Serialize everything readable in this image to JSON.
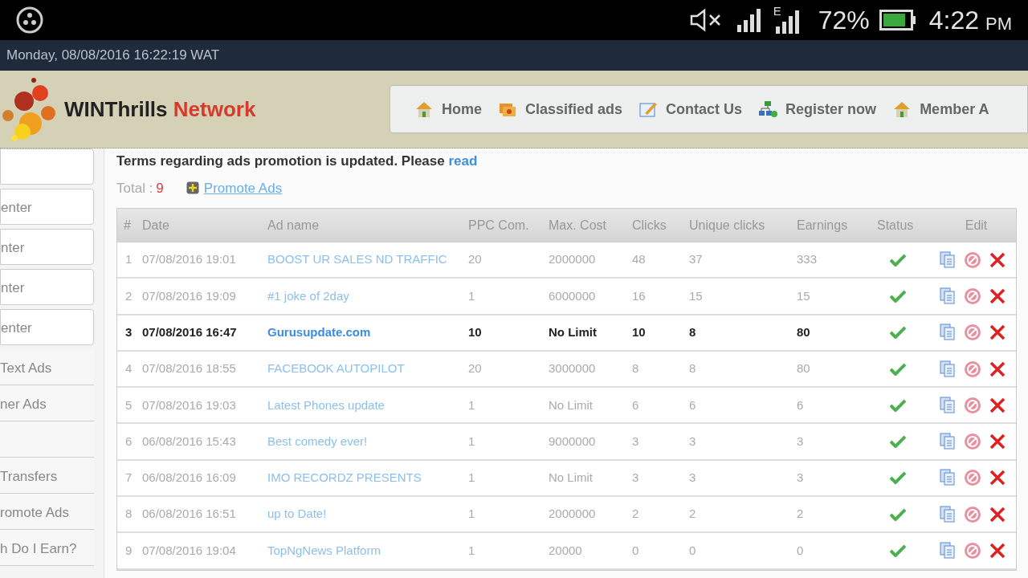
{
  "phone_status": {
    "network_type": "E",
    "battery": "72%",
    "time": "4:22",
    "ampm": "PM",
    "muted": true
  },
  "date_bar": "Monday, 08/08/2016 16:22:19 WAT",
  "logo": {
    "brand": "WINThrills",
    "suffix": "Network"
  },
  "nav": [
    {
      "label": "Home"
    },
    {
      "label": "Classified ads"
    },
    {
      "label": "Contact Us"
    },
    {
      "label": "Register now"
    },
    {
      "label": "Member A"
    }
  ],
  "sidebar": [
    {
      "kind": "box"
    },
    {
      "kind": "box",
      "label": "enter"
    },
    {
      "kind": "box",
      "label": "nter"
    },
    {
      "kind": "box",
      "label": "nter"
    },
    {
      "kind": "box",
      "label": "enter"
    },
    {
      "kind": "row",
      "label": "Text Ads"
    },
    {
      "kind": "row",
      "label": "ner Ads"
    },
    {
      "kind": "row"
    },
    {
      "kind": "row",
      "label": "Transfers"
    },
    {
      "kind": "row",
      "label": "romote Ads"
    },
    {
      "kind": "row",
      "label": "h Do I Earn?"
    }
  ],
  "notice": {
    "text": "Terms regarding ads promotion is updated. Please",
    "link": "read"
  },
  "total": {
    "label": "Total :",
    "value": "9"
  },
  "promote_link": "Promote Ads",
  "table": {
    "columns": [
      "#",
      "Date",
      "Ad name",
      "PPC Com.",
      "Max. Cost",
      "Clicks",
      "Unique clicks",
      "Earnings",
      "Status",
      "Edit"
    ],
    "rows": [
      {
        "cells": [
          "1",
          "07/08/2016 19:01",
          "BOOST UR SALES ND TRAFFIC",
          "20",
          "2000000",
          "48",
          "37",
          "333"
        ],
        "highlighted": false,
        "active": true
      },
      {
        "cells": [
          "2",
          "07/08/2016 19:09",
          "#1 joke of 2day",
          "1",
          "6000000",
          "16",
          "15",
          "15"
        ],
        "highlighted": false,
        "active": true
      },
      {
        "cells": [
          "3",
          "07/08/2016 16:47",
          "Gurusupdate.com",
          "10",
          "No Limit",
          "10",
          "8",
          "80"
        ],
        "highlighted": true,
        "active": true
      },
      {
        "cells": [
          "4",
          "07/08/2016 18:55",
          "FACEBOOK AUTOPILOT",
          "20",
          "3000000",
          "8",
          "8",
          "80"
        ],
        "highlighted": false,
        "active": true
      },
      {
        "cells": [
          "5",
          "07/08/2016 19:03",
          "Latest Phones update",
          "1",
          "No Limit",
          "6",
          "6",
          "6"
        ],
        "highlighted": false,
        "active": true
      },
      {
        "cells": [
          "6",
          "06/08/2016 15:43",
          "Best comedy ever!",
          "1",
          "9000000",
          "3",
          "3",
          "3"
        ],
        "highlighted": false,
        "active": true
      },
      {
        "cells": [
          "7",
          "06/08/2016 16:09",
          "IMO RECORDZ PRESENTS",
          "1",
          "No Limit",
          "3",
          "3",
          "3"
        ],
        "highlighted": false,
        "active": true
      },
      {
        "cells": [
          "8",
          "06/08/2016 16:51",
          "up to Date!",
          "1",
          "2000000",
          "2",
          "2",
          "2"
        ],
        "highlighted": false,
        "active": true
      },
      {
        "cells": [
          "9",
          "07/08/2016 19:04",
          "TopNgNews Platform",
          "1",
          "20000",
          "0",
          "0",
          "0"
        ],
        "highlighted": false,
        "active": true
      }
    ]
  }
}
